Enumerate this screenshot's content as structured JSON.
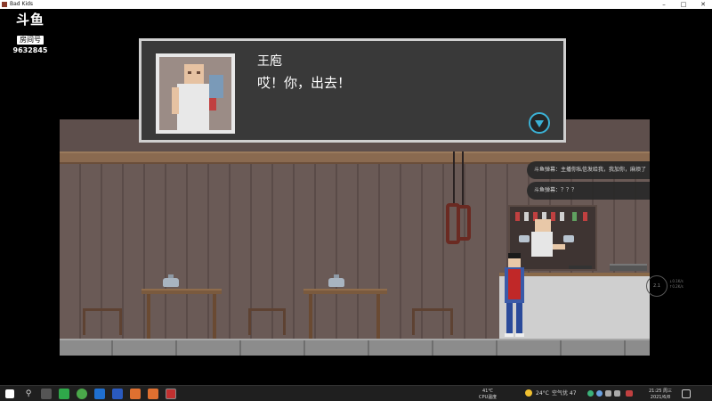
{
  "window": {
    "title": "Bad Kids"
  },
  "stream": {
    "logo": "斗鱼",
    "tag": "房间号",
    "room_id": "9632845"
  },
  "dialog": {
    "speaker": "王庖",
    "line": "哎！你，出去！"
  },
  "chat": [
    {
      "text": "斗鱼弹幕：主播你私信发给我，我加你，麻烦了"
    },
    {
      "text": "斗鱼弹幕：？？？"
    }
  ],
  "speed_widget": {
    "value": "2.1",
    "label": "↓0.1K/s\n↑0.2K/s"
  },
  "taskbar": {
    "weather_small": {
      "temp": "41℃",
      "label": "CPU温度"
    },
    "weather": {
      "temp": "24°C",
      "label": "空气优 47"
    },
    "clock": {
      "time": "21:25 周三",
      "date": "2021/6/8"
    }
  },
  "colors": {
    "dialog_bg": "#393939",
    "dialog_border": "#cfcfcf",
    "accent": "#3bb2d6"
  }
}
